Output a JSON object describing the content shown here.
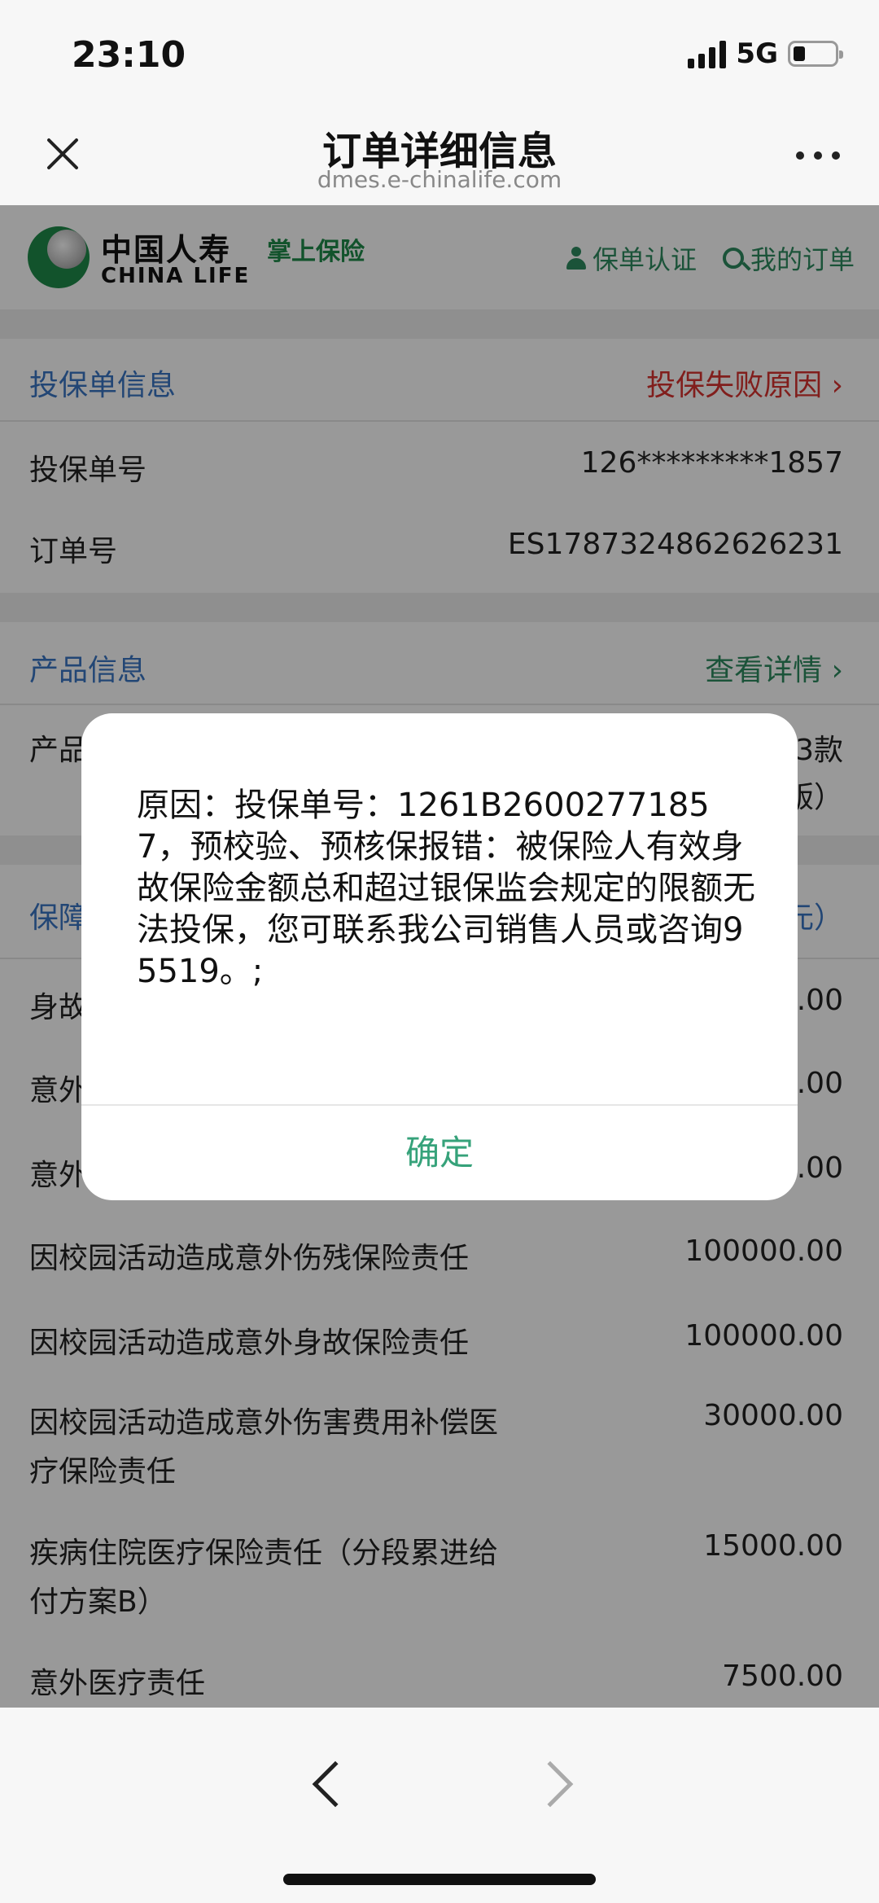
{
  "status_bar": {
    "time": "23:10",
    "network": "5G"
  },
  "nav": {
    "title": "订单详细信息",
    "url": "dmes.e-chinalife.com"
  },
  "header": {
    "logo_cn": "中国人寿",
    "logo_en": "CHINA LIFE",
    "slogan": "掌上保险",
    "link_policy_verify": "保单认证",
    "link_my_orders": "我的订单"
  },
  "application_info": {
    "section_title": "投保单信息",
    "fail_reason_link": "投保失败原因 ›",
    "rows": [
      {
        "label": "投保单号",
        "value": "126*********1857"
      },
      {
        "label": "订单号",
        "value": "ES1787324862626231"
      }
    ]
  },
  "product_info": {
    "section_title": "产品信息",
    "details_link": "查看详情 ›",
    "product_label_partial": "产品",
    "product_value_partial_1": "3款",
    "product_value_partial_2": "版）"
  },
  "coverage": {
    "section_title_partial": "保障",
    "section_right_partial": "元）",
    "partial_rows": [
      {
        "label": "身故",
        "value": ".00"
      },
      {
        "label": "意外",
        "value": ".00"
      },
      {
        "label": "意外",
        "value": ".00"
      }
    ],
    "rows": [
      {
        "label": "因校园活动造成意外伤残保险责任",
        "value": "100000.00"
      },
      {
        "label": "因校园活动造成意外身故保险责任",
        "value": "100000.00"
      },
      {
        "label": "因校园活动造成意外伤害费用补偿医",
        "label2": "疗保险责任",
        "value": "30000.00"
      },
      {
        "label": "疾病住院医疗保险责任（分段累进给",
        "label2": "付方案B）",
        "value": "15000.00"
      },
      {
        "label": "意外医疗责任",
        "value": "7500.00"
      }
    ]
  },
  "modal": {
    "message": "原因：投保单号：1261B26002771857，预校验、预核保报错：被保险人有效身故保险金额总和超过银保监会规定的限额无法投保，您可联系我公司销售人员或咨询95519。;",
    "confirm_label": "确定"
  }
}
